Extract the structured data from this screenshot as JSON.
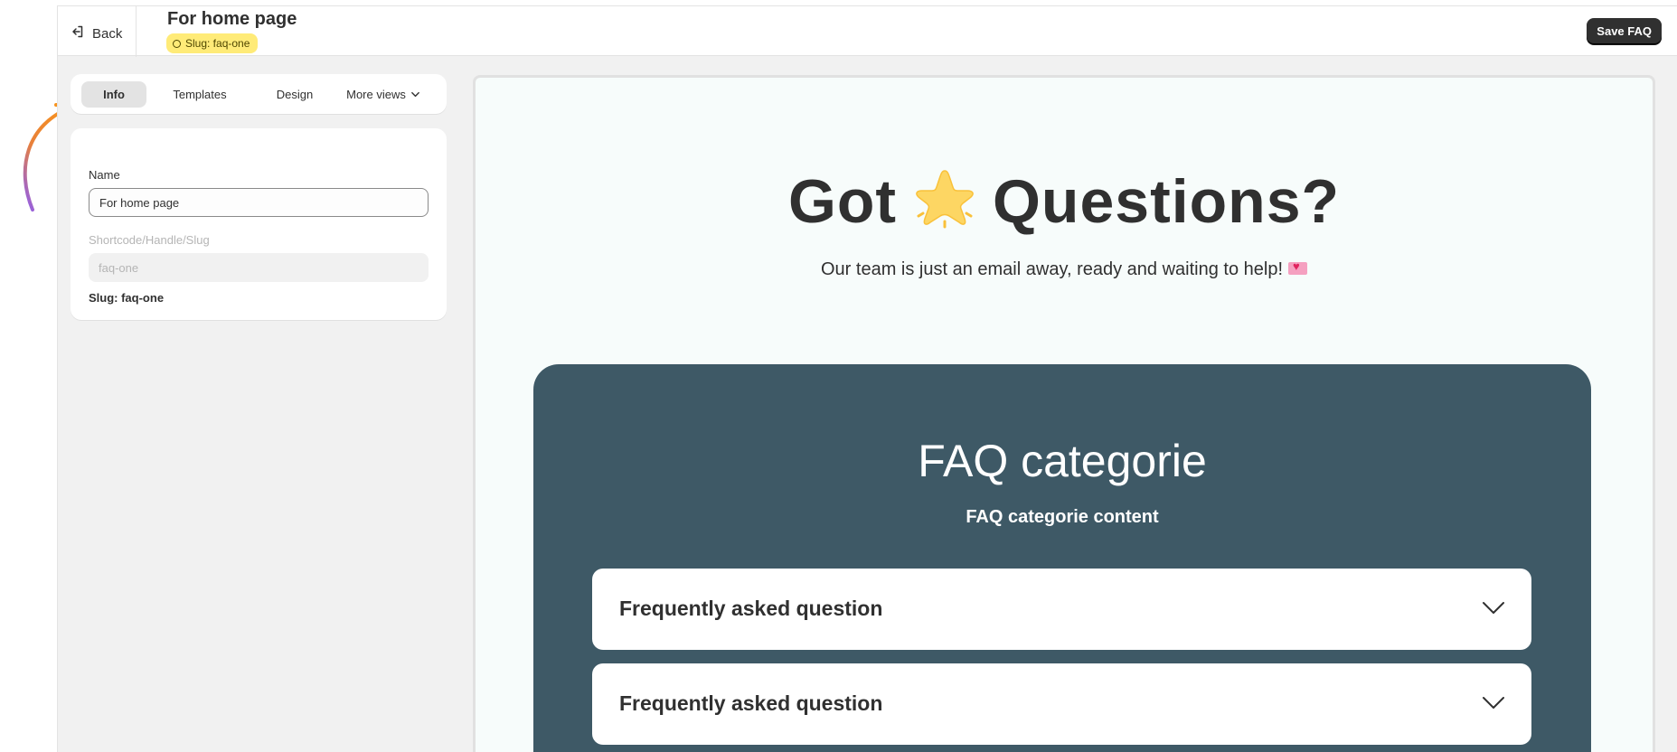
{
  "topbar": {
    "back_label": "Back",
    "title": "For home page",
    "slug_badge": "Slug: faq-one",
    "save_label": "Save FAQ"
  },
  "tabs": [
    {
      "label": "Info",
      "active": true
    },
    {
      "label": "Templates",
      "active": false
    },
    {
      "label": "Design",
      "active": false
    },
    {
      "label": "More views",
      "active": false
    }
  ],
  "info_form": {
    "name_label": "Name",
    "name_value": "For home page",
    "slug_label": "Shortcode/Handle/Slug",
    "slug_placeholder": "faq-one",
    "slug_text": "Slug: faq-one"
  },
  "preview": {
    "hero_title_before": "Got",
    "hero_title_after": "Questions?",
    "hero_icon": "star-icon",
    "hero_subtitle": "Our team is just an email away, ready and waiting to help!",
    "hero_sub_icon": "love-letter-icon",
    "category_title": "FAQ categorie",
    "category_subtitle": "FAQ categorie content",
    "faq_items": [
      {
        "question": "Frequently asked question"
      },
      {
        "question": "Frequently asked question"
      }
    ]
  },
  "colors": {
    "badge_bg": "#ffeb78",
    "primary_button": "#303030",
    "faq_section_bg": "#3e5966",
    "preview_bg": "#f7fcfb",
    "arrow_start": "#f7931e",
    "arrow_end": "#8b5cf6"
  }
}
